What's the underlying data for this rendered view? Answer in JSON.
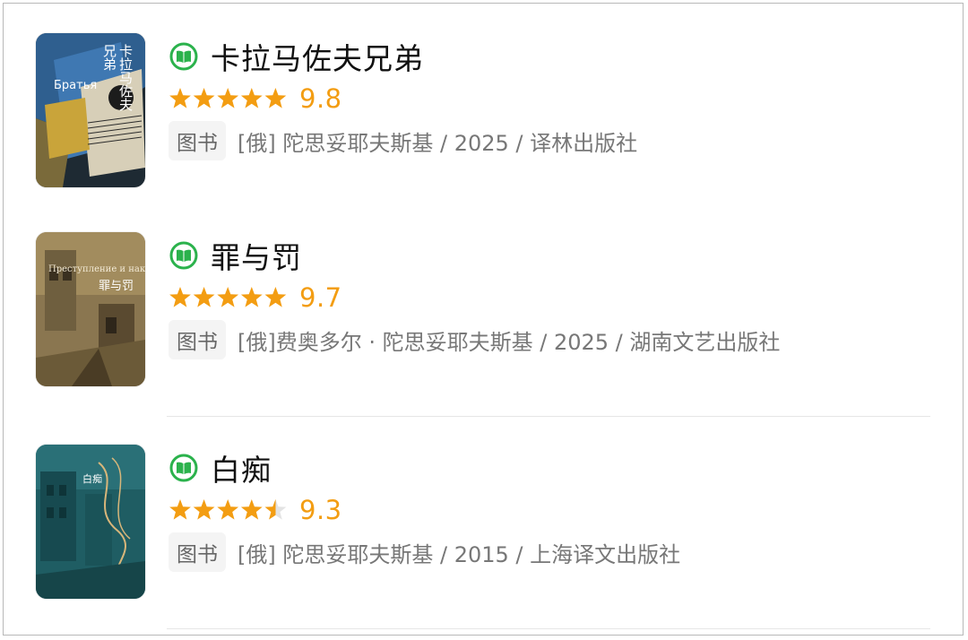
{
  "books": [
    {
      "title": "卡拉马佐夫兄弟",
      "rating": 9.8,
      "rating_text": "9.8",
      "stars_out_of_5": 5,
      "tag": "图书",
      "meta": "[俄] 陀思妥耶夫斯基 / 2025 / 译林出版社",
      "cover_text_cn": "卡拉马佐夫",
      "cover_text_cn2": "兄弟",
      "cover_text_ru": "Братья"
    },
    {
      "title": "罪与罚",
      "rating": 9.7,
      "rating_text": "9.7",
      "stars_out_of_5": 5,
      "tag": "图书",
      "meta": "[俄]费奥多尔 · 陀思妥耶夫斯基 / 2025 / 湖南文艺出版社",
      "cover_text_cn": "罪与罚",
      "cover_text_ru": "Преступление и наказание"
    },
    {
      "title": "白痴",
      "rating": 9.3,
      "rating_text": "9.3",
      "stars_out_of_5": 4.5,
      "tag": "图书",
      "meta": "[俄] 陀思妥耶夫斯基 / 2015 / 上海译文出版社",
      "cover_text_cn": "白痴"
    }
  ],
  "icons": {
    "book_badge": "green-book-icon",
    "star": "star-icon"
  },
  "colors": {
    "badge_green": "#2bb24c",
    "star_orange": "#f39d12",
    "star_empty": "#e3e3e3",
    "score_orange": "#f39d12"
  }
}
